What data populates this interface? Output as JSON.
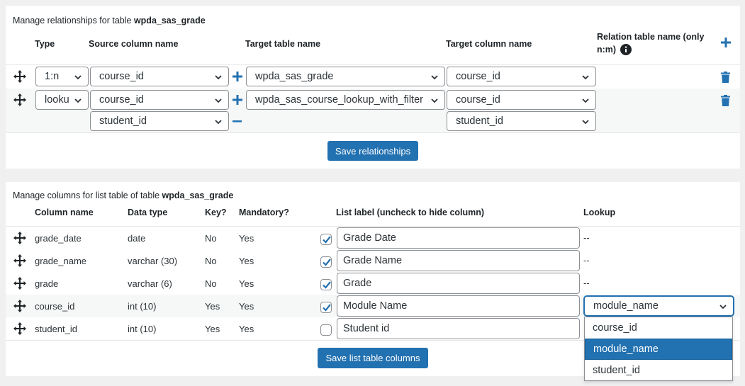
{
  "relationships": {
    "caption_prefix": "Manage relationships for table",
    "table_name": "wpda_sas_grade",
    "headers": {
      "type": "Type",
      "source_column": "Source column name",
      "target_table": "Target table name",
      "target_column": "Target column name",
      "relation_table_line1": "Relation table name (only",
      "relation_table_line2": "n:m)"
    },
    "rows": [
      {
        "type": "1:n",
        "source": "course_id",
        "target_table": "wpda_sas_grade",
        "target_column": "course_id"
      },
      {
        "type": "looku",
        "source": "course_id",
        "target_table": "wpda_sas_course_lookup_with_filter",
        "target_column": "course_id",
        "extra_source": "student_id",
        "extra_target_column": "student_id"
      }
    ],
    "save_label": "Save relationships"
  },
  "columns": {
    "caption_prefix": "Manage columns for list table of table",
    "table_name": "wpda_sas_grade",
    "headers": {
      "column_name": "Column name",
      "data_type": "Data type",
      "key": "Key?",
      "mandatory": "Mandatory?",
      "list_label": "List label (uncheck to hide column)",
      "lookup": "Lookup"
    },
    "rows": [
      {
        "name": "grade_date",
        "type": "date",
        "key": "No",
        "mandatory": "Yes",
        "checked": true,
        "label": "Grade Date",
        "lookup": "--"
      },
      {
        "name": "grade_name",
        "type": "varchar (30)",
        "key": "No",
        "mandatory": "Yes",
        "checked": true,
        "label": "Grade Name",
        "lookup": "--"
      },
      {
        "name": "grade",
        "type": "varchar (6)",
        "key": "No",
        "mandatory": "Yes",
        "checked": true,
        "label": "Grade",
        "lookup": "--"
      },
      {
        "name": "course_id",
        "type": "int (10)",
        "key": "Yes",
        "mandatory": "Yes",
        "checked": true,
        "label": "Module Name",
        "lookup": "module_name"
      },
      {
        "name": "student_id",
        "type": "int (10)",
        "key": "Yes",
        "mandatory": "Yes",
        "checked": false,
        "label": "Student id",
        "lookup": ""
      }
    ],
    "lookup_options": [
      "course_id",
      "module_name",
      "student_id"
    ],
    "lookup_selected": "module_name",
    "save_label": "Save list table columns"
  },
  "colors": {
    "accent": "#2271b1",
    "border": "#8c8f94",
    "text": "#2c3338"
  }
}
